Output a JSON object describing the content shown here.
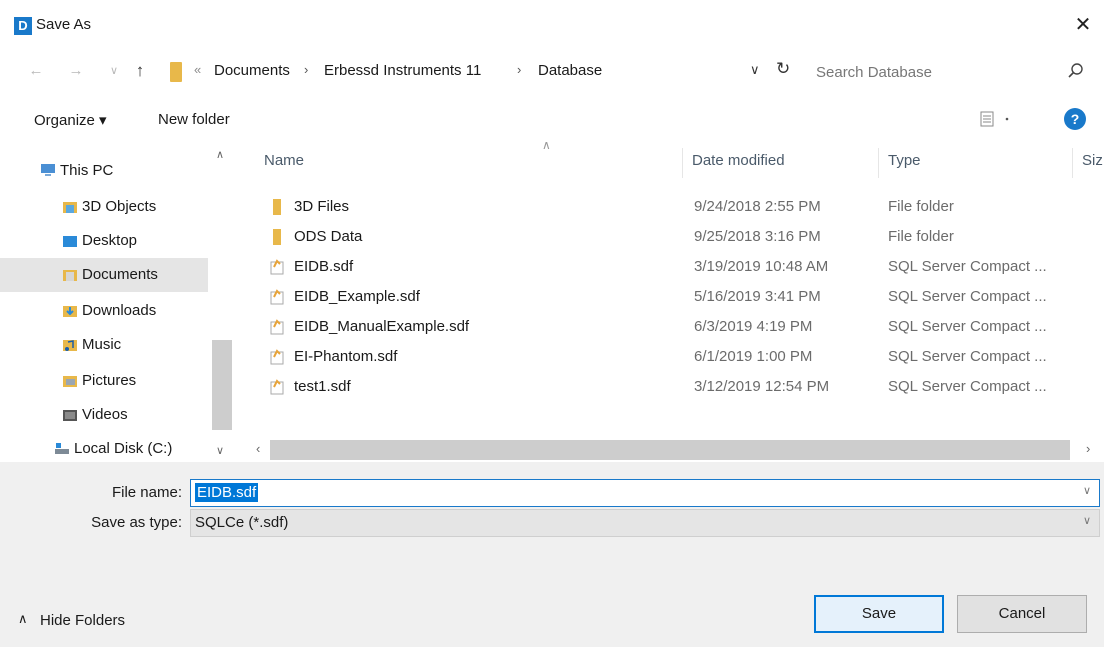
{
  "window": {
    "app_icon_letter": "D",
    "title": "Save As",
    "close_glyph": "✕"
  },
  "nav": {
    "back_icon": "arrow-left-icon",
    "forward_icon": "arrow-right-icon",
    "recent_icon": "chevron-down-icon",
    "up_icon": "arrow-up-icon",
    "address_prefix": "«",
    "breadcrumbs": [
      "Documents",
      "Erbessd Instruments 11",
      "Database"
    ],
    "separator": "›",
    "search_placeholder": "Search Database"
  },
  "toolbar": {
    "organize_label": "Organize ▾",
    "new_folder_label": "New folder",
    "view_icon": "view-options-icon",
    "help_label": "?"
  },
  "sidebar": {
    "items": [
      {
        "label": "This PC",
        "icon": "computer-icon",
        "color": "#4a8fd4",
        "selected": false
      },
      {
        "label": "3D Objects",
        "icon": "3d-objects-icon",
        "color": "#5aa8e0",
        "selected": false
      },
      {
        "label": "Desktop",
        "icon": "desktop-icon",
        "color": "#2a8ad8",
        "selected": false
      },
      {
        "label": "Documents",
        "icon": "documents-icon",
        "color": "#c8c8c8",
        "selected": true
      },
      {
        "label": "Downloads",
        "icon": "downloads-icon",
        "color": "#2a8ad8",
        "selected": false
      },
      {
        "label": "Music",
        "icon": "music-icon",
        "color": "#e8a43a",
        "selected": false
      },
      {
        "label": "Pictures",
        "icon": "pictures-icon",
        "color": "#9aa6b2",
        "selected": false
      },
      {
        "label": "Videos",
        "icon": "videos-icon",
        "color": "#555555",
        "selected": false
      },
      {
        "label": "Local Disk (C:)",
        "icon": "local-disk-icon",
        "color": "#7d8a96",
        "selected": false
      }
    ]
  },
  "file_list": {
    "columns": [
      "Name",
      "Date modified",
      "Type",
      "Siz"
    ],
    "rows": [
      {
        "name": "3D Files",
        "date": "9/24/2018 2:55 PM",
        "type": "File folder",
        "kind": "folder"
      },
      {
        "name": "ODS Data",
        "date": "9/25/2018 3:16 PM",
        "type": "File folder",
        "kind": "folder"
      },
      {
        "name": "EIDB.sdf",
        "date": "3/19/2019 10:48 AM",
        "type": "SQL Server Compact ...",
        "kind": "file"
      },
      {
        "name": "EIDB_Example.sdf",
        "date": "5/16/2019 3:41 PM",
        "type": "SQL Server Compact ...",
        "kind": "file"
      },
      {
        "name": "EIDB_ManualExample.sdf",
        "date": "6/3/2019 4:19 PM",
        "type": "SQL Server Compact ...",
        "kind": "file"
      },
      {
        "name": "EI-Phantom.sdf",
        "date": "6/1/2019 1:00 PM",
        "type": "SQL Server Compact ...",
        "kind": "file"
      },
      {
        "name": "test1.sdf",
        "date": "3/12/2019 12:54 PM",
        "type": "SQL Server Compact ...",
        "kind": "file"
      }
    ]
  },
  "form": {
    "file_name_label": "File name:",
    "file_name_value": "EIDB.sdf",
    "save_type_label": "Save as type:",
    "save_type_value": "SQLCe (*.sdf)"
  },
  "footer": {
    "hide_folders_label": "Hide Folders",
    "save_label": "Save",
    "cancel_label": "Cancel"
  },
  "colors": {
    "accent": "#0078d7",
    "folder": "#e8b84a",
    "selection": "#e5e5e5"
  }
}
